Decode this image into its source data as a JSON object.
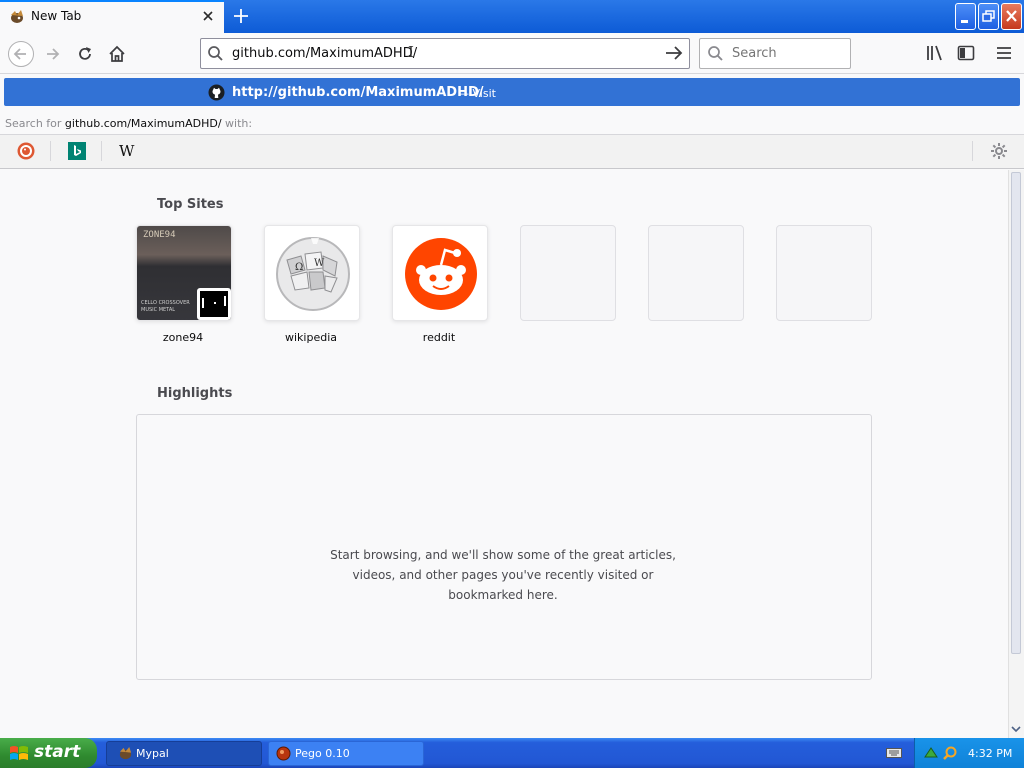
{
  "window": {
    "tab_title": "New Tab",
    "accent": "#0a84ff"
  },
  "navbar": {
    "url_value": "github.com/MaximumADHD/",
    "search_placeholder": "Search"
  },
  "autocomplete": {
    "url": "http://github.com/MaximumADHD/",
    "action": "— Visit",
    "search_with_prefix": "Search for",
    "search_with_term": "github.com/MaximumADHD/",
    "search_with_suffix": "with:",
    "engines": [
      "duckduckgo-icon",
      "bing-icon",
      "wikipedia-icon"
    ],
    "wiki_glyph": "W",
    "highlight_color": "#3272d5"
  },
  "content": {
    "top_sites_title": "Top Sites",
    "top_sites": [
      {
        "label": "zone94"
      },
      {
        "label": "wikipedia"
      },
      {
        "label": "reddit"
      },
      {
        "label": ""
      },
      {
        "label": ""
      },
      {
        "label": ""
      }
    ],
    "zone94_logo": "ZONE94",
    "zone94_caption": "CELLO CROSSOVER MUSIC METAL",
    "highlights_title": "Highlights",
    "highlights_message": "Start browsing, and we'll show some of the great articles, videos, and other pages you've recently visited or bookmarked here."
  },
  "taskbar": {
    "start_label": "start",
    "tasks": [
      {
        "label": "Mypal"
      },
      {
        "label": "Pego 0.10"
      }
    ],
    "clock": "4:32 PM"
  }
}
